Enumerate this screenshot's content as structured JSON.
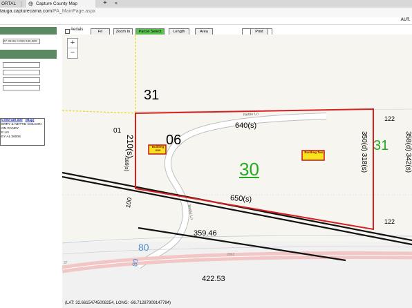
{
  "browser": {
    "left_tab_title": "ORTAL",
    "active_tab_title": "Capture County Map",
    "close_glyph": "×",
    "new_tab_glyph": "+",
    "url_host": "tauga.capturecama.com",
    "url_path": "/PA_MainPage.aspx",
    "site_header_right": "AUT."
  },
  "sidebar": {
    "inputs": [
      {
        "value": "07 03 06 0 000 030.000"
      },
      {
        "value": ""
      },
      {
        "value": ""
      },
      {
        "value": ""
      },
      {
        "value": ""
      }
    ],
    "owner": {
      "parcel_link": "0.000 030.000",
      "map_link": "(Map)",
      "line1": "ERRY & NETTIE GOLSON",
      "line2": "ON RANDY",
      "line3": "E LN",
      "line4": "EY AL 36006"
    }
  },
  "toolbar": {
    "aerials_label": "Aerials",
    "fit": "Fit",
    "zoom_in": "Zoom In",
    "parcel_select": "Parcel Select",
    "length": "Length",
    "area": "Area",
    "print": "Print"
  },
  "map": {
    "zoom_in": "+",
    "zoom_out": "−",
    "labels": {
      "section_31_top": "31",
      "parcel_01": "01",
      "parcel_06": "06",
      "dim_210": "210(s)",
      "dim_189": "189(s)",
      "dim_640": "640(s)",
      "road_nettie_top": "Nettie Ln",
      "road_nettie_bottom": "Nettie Ln",
      "dim_350": "350(d) 318(s)",
      "dim_358": "358(d) 342(s)",
      "parcel_122_top": "122",
      "parcel_122_bottom": "122",
      "section_31_right": "31",
      "parcel_30": "30",
      "dim_650": "650(s)",
      "label_100": "100",
      "dim_359": "359.46",
      "route_80_a": "80",
      "route_80_b": "80",
      "small_2062": "2062",
      "small_37": "37",
      "dim_422": "422.53"
    },
    "building_one": "Building one",
    "building_two": "Building Two",
    "colors": {
      "parcel_outline": "#d42020",
      "section_green": "#22aa22",
      "building_fill": "#f6e21d",
      "route_blue": "#4a8fd0",
      "road_fill": "#ffffff"
    }
  },
  "coordinates": "(LAT: 32.66154745008254, LONG: -86.71287909147784)"
}
